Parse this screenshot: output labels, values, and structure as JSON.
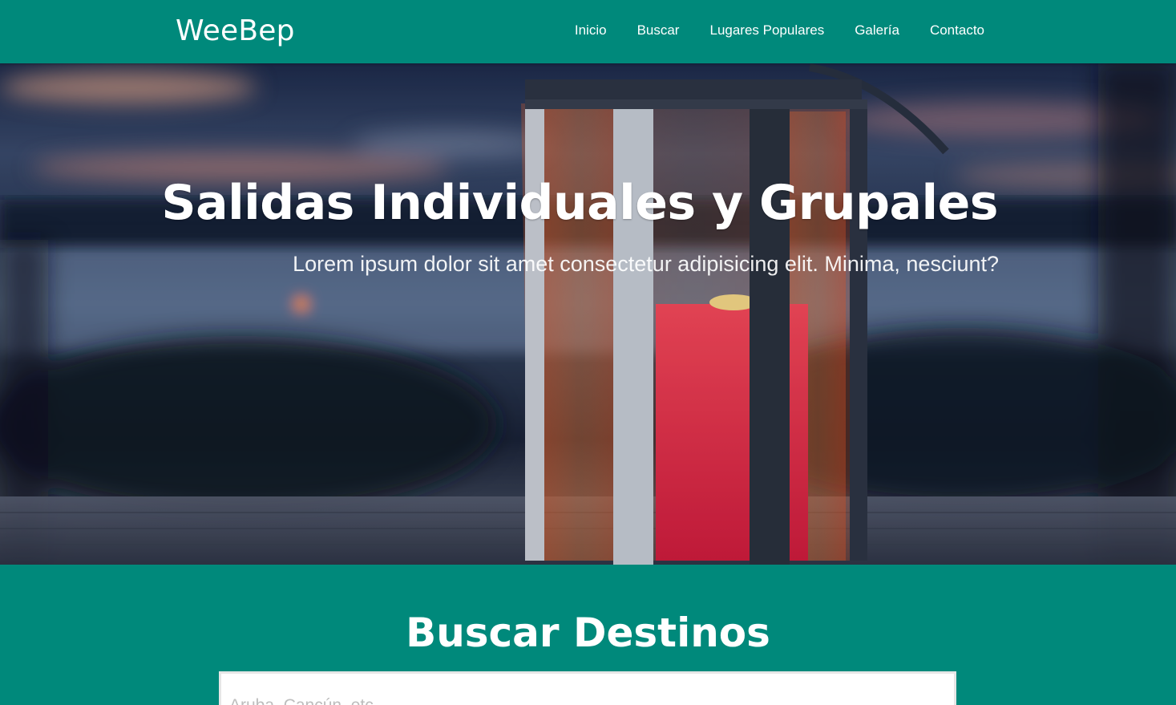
{
  "header": {
    "logo": "WeeBep",
    "nav": [
      {
        "label": "Inicio"
      },
      {
        "label": "Buscar"
      },
      {
        "label": "Lugares Populares"
      },
      {
        "label": "Galería"
      },
      {
        "label": "Contacto"
      }
    ]
  },
  "hero": {
    "title": "Salidas Individuales y Grupales",
    "subtitle": "Lorem ipsum dolor sit amet consectetur adipisicing elit. Minima, nesciunt?"
  },
  "search": {
    "title": "Buscar Destinos",
    "placeholder": "Aruba, Cancún, etc"
  },
  "colors": {
    "primary": "#00897b",
    "text": "#ffffff"
  }
}
